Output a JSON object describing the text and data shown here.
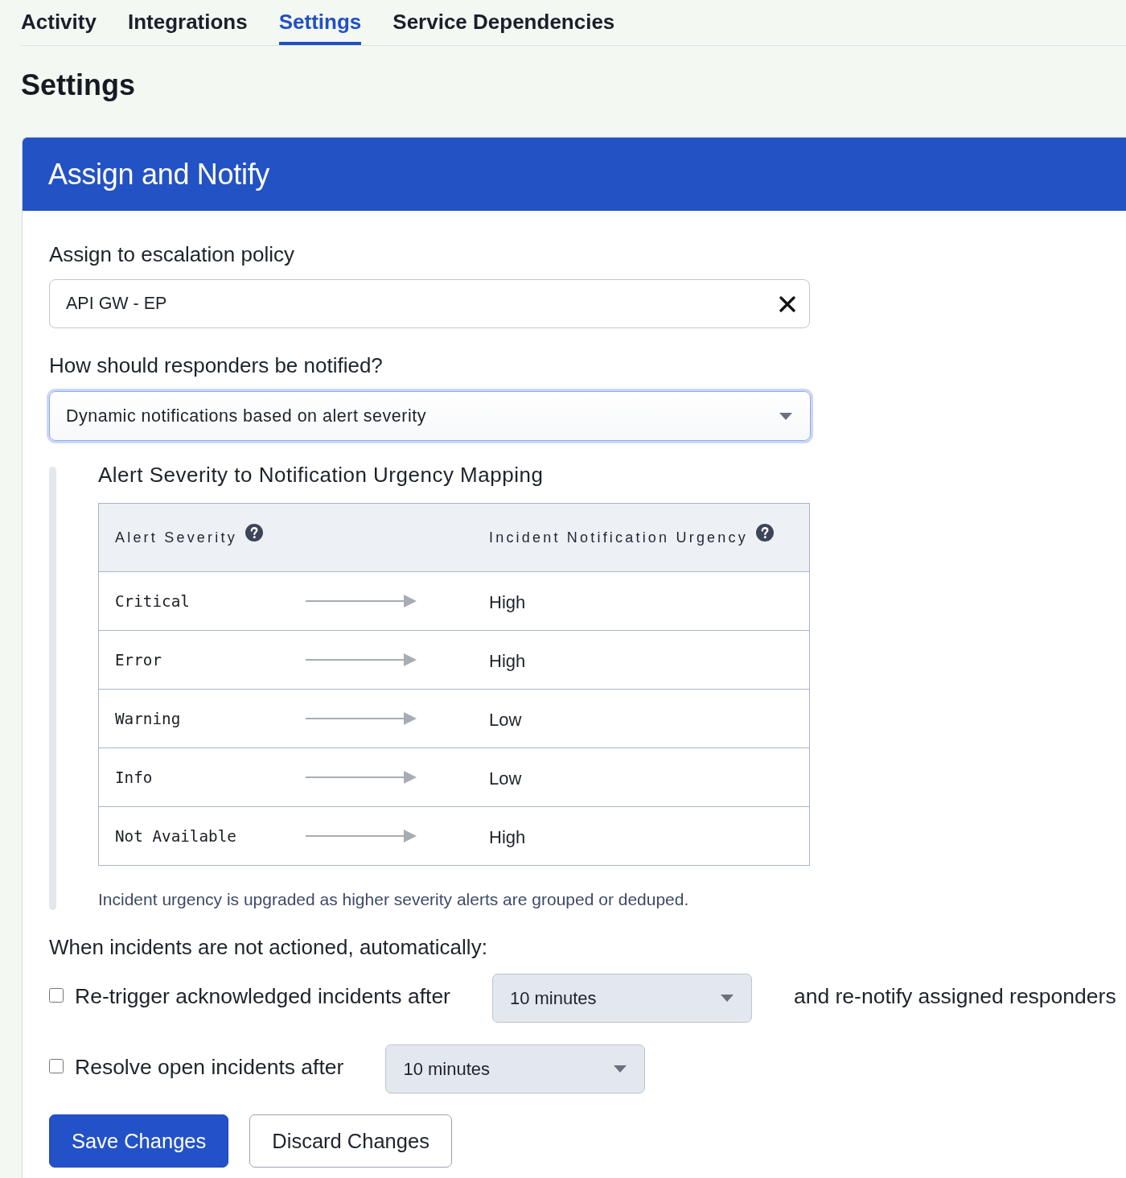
{
  "tabs": [
    {
      "label": "Activity",
      "selected": false
    },
    {
      "label": "Integrations",
      "selected": false
    },
    {
      "label": "Settings",
      "selected": true
    },
    {
      "label": "Service Dependencies",
      "selected": false
    }
  ],
  "page_title": "Settings",
  "card": {
    "title": "Assign and Notify",
    "escalation_policy": {
      "label": "Assign to escalation policy",
      "value": "API GW - EP"
    },
    "notification": {
      "label": "How should responders be notified?",
      "value": "Dynamic notifications based on alert severity",
      "focused": true
    },
    "mapping": {
      "title": "Alert Severity to Notification Urgency Mapping",
      "columns": [
        "Alert Severity",
        "Incident Notification Urgency"
      ],
      "rows": [
        {
          "severity": "Critical",
          "urgency": "High"
        },
        {
          "severity": "Error",
          "urgency": "High"
        },
        {
          "severity": "Warning",
          "urgency": "Low"
        },
        {
          "severity": "Info",
          "urgency": "Low"
        },
        {
          "severity": "Not Available",
          "urgency": "High"
        }
      ],
      "note": "Incident urgency is upgraded as higher severity alerts are grouped or deduped."
    },
    "automation": {
      "label": "When incidents are not actioned, automatically:",
      "rules": [
        {
          "label": "Re-trigger acknowledged incidents after",
          "checked": false,
          "value": "10 minutes",
          "suffix": "and re-notify assigned responders"
        },
        {
          "label": "Resolve open incidents after",
          "checked": false,
          "value": "10 minutes"
        }
      ]
    },
    "buttons": [
      {
        "label": "Save Changes",
        "kind": "primary"
      },
      {
        "label": "Discard Changes",
        "kind": "secondary"
      }
    ]
  }
}
